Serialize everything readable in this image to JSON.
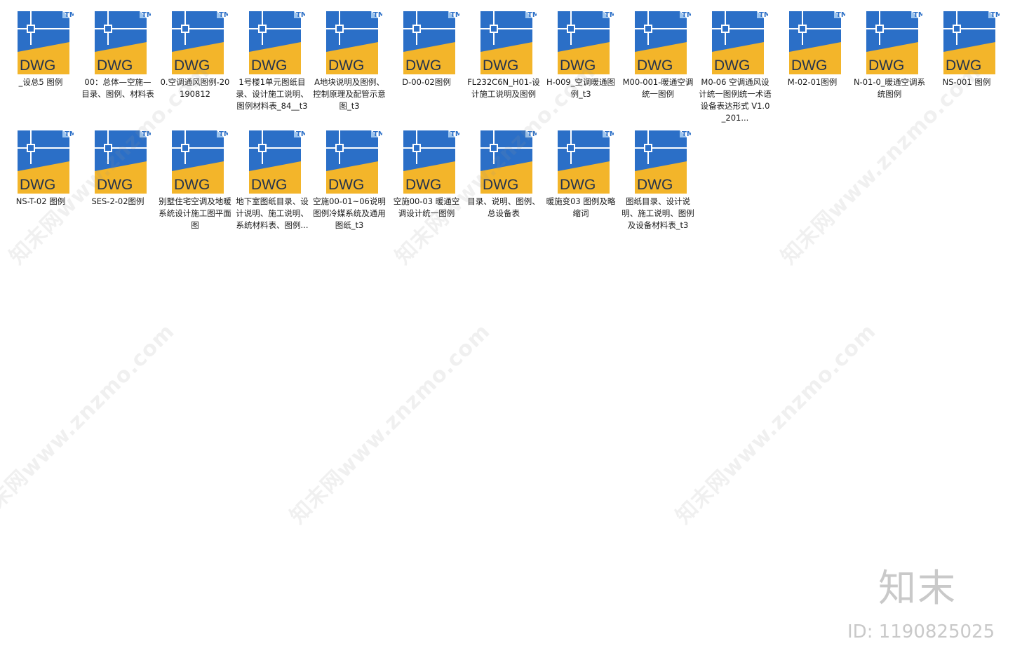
{
  "icon": {
    "name": "dwg-file-icon",
    "text": "DWG",
    "tm": "TM",
    "colors": {
      "blue": "#2b6fc7",
      "blue_light": "#4f97e3",
      "yellow": "#f3b52a",
      "fold": "#9cc4ee",
      "white": "#ffffff"
    }
  },
  "files": [
    {
      "label": "_设总5 图例"
    },
    {
      "label": "00：总体—空施—目录、图例、材料表"
    },
    {
      "label": "0.空调通风图例-20190812"
    },
    {
      "label": "1号楼1单元图纸目录、设计施工说明、图例材料表_84__t3"
    },
    {
      "label": "A地块说明及图例、控制原理及配管示意图_t3"
    },
    {
      "label": "D-00-02图例"
    },
    {
      "label": "FL232C6N_H01-设计施工说明及图例"
    },
    {
      "label": "H-009_空调暖通图例_t3"
    },
    {
      "label": "M00-001-暖通空调统一图例"
    },
    {
      "label": "M0-06 空调通风设计统一图例统一术语设备表达形式 V1.0_201..."
    },
    {
      "label": "M-02-01图例"
    },
    {
      "label": "N-01-0_暖通空调系统图例"
    },
    {
      "label": "NS-001 图例"
    },
    {
      "label": "NS-T-02 图例"
    },
    {
      "label": "SES-2-02图例"
    },
    {
      "label": "别墅住宅空调及地暖系统设计施工图平面图"
    },
    {
      "label": "地下室图纸目录、设计说明、施工说明、系统材料表、图例..."
    },
    {
      "label": "空施00-01~06说明 图例冷媒系统及通用图纸_t3"
    },
    {
      "label": "空施00-03 暖通空调设计统一图例"
    },
    {
      "label": "目录、说明、图例、总设备表"
    },
    {
      "label": "暖施变03 图例及略缩词"
    },
    {
      "label": "图纸目录、设计说明、施工说明、图例及设备材料表_t3"
    }
  ],
  "watermark": {
    "text": "知末网www.znzmo.com",
    "brand": "知末",
    "id_text": "ID: 1190825025"
  }
}
